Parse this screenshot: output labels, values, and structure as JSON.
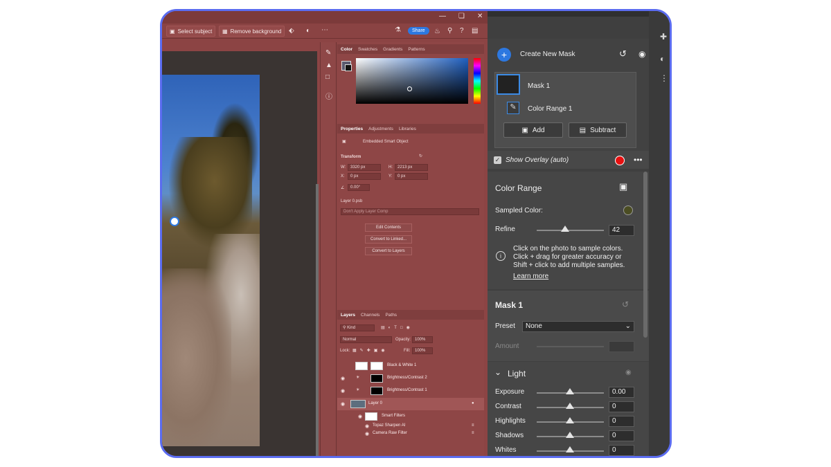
{
  "photoshop": {
    "options_bar": {
      "select_subject": "Select subject",
      "remove_background": "Remove background",
      "share": "Share"
    },
    "color_panel": {
      "tabs": [
        "Color",
        "Swatches",
        "Gradients",
        "Patterns"
      ]
    },
    "properties_panel": {
      "tabs": [
        "Properties",
        "Adjustments",
        "Libraries"
      ],
      "object_type": "Embedded Smart Object",
      "transform_label": "Transform",
      "w": "3320 px",
      "h": "2213 px",
      "x": "0 px",
      "y": "0 px",
      "angle": "0.00°",
      "file_name": "Layer 0.psb",
      "layer_comp_placeholder": "Don't Apply Layer Comp",
      "buttons": [
        "Edit Contents",
        "Convert to Linked...",
        "Convert to Layers"
      ]
    },
    "layers_panel": {
      "tabs": [
        "Layers",
        "Channels",
        "Paths"
      ],
      "filter_kind": "Kind",
      "blend_mode": "Normal",
      "opacity_label": "Opacity:",
      "opacity_value": "100%",
      "lock_label": "Lock:",
      "fill_label": "Fill:",
      "fill_value": "100%",
      "layers": [
        {
          "name": "Black & White 1"
        },
        {
          "name": "Brightness/Contrast 2"
        },
        {
          "name": "Brightness/Contrast 1"
        },
        {
          "name": "Layer 0"
        },
        {
          "name": "Smart Filters"
        },
        {
          "name": "Topaz Sharpen AI"
        },
        {
          "name": "Camera Raw Filter"
        }
      ]
    }
  },
  "camera_raw": {
    "create_new_mask": "Create New Mask",
    "mask_name": "Mask 1",
    "component_name": "Color Range 1",
    "add_label": "Add",
    "subtract_label": "Subtract",
    "show_overlay": "Show Overlay (auto)",
    "overlay_color": "#e71010",
    "color_range_title": "Color Range",
    "sampled_color_label": "Sampled Color:",
    "sampled_color": "#4b4d23",
    "refine_label": "Refine",
    "refine_value": "42",
    "refine_fraction": 0.42,
    "help_line1": "Click on the photo to sample colors.",
    "help_line2": "Click + drag for greater accuracy or",
    "help_line3": "Shift + click to add multiple samples.",
    "learn_more": "Learn more",
    "mask_section_title": "Mask 1",
    "preset_label": "Preset",
    "preset_value": "None",
    "amount_label": "Amount",
    "light_title": "Light",
    "sliders": [
      {
        "label": "Exposure",
        "value": "0.00"
      },
      {
        "label": "Contrast",
        "value": "0"
      },
      {
        "label": "Highlights",
        "value": "0"
      },
      {
        "label": "Shadows",
        "value": "0"
      },
      {
        "label": "Whites",
        "value": "0"
      }
    ]
  }
}
